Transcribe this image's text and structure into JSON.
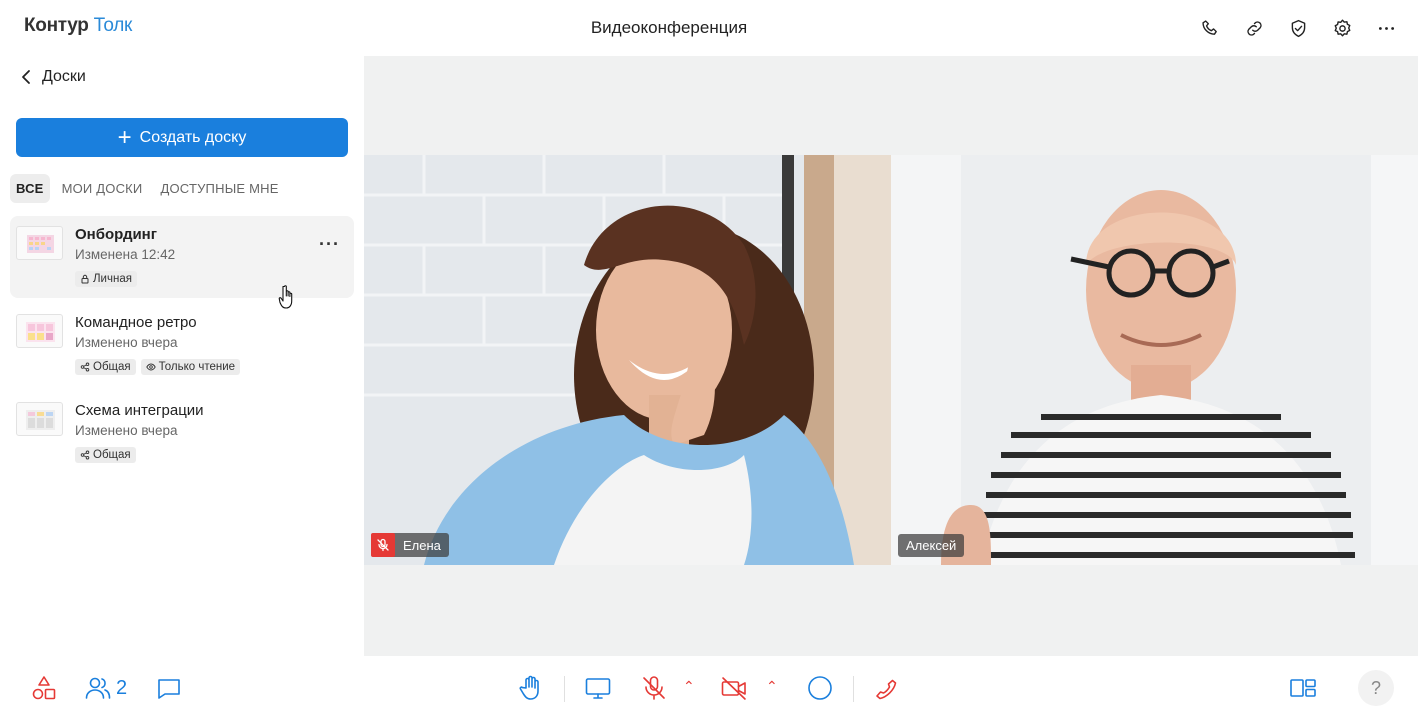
{
  "header": {
    "logo_brand": "Контур",
    "logo_product": "Толк",
    "title": "Видеоконференция",
    "icons": [
      "phone-icon",
      "link-icon",
      "shield-check-icon",
      "gear-icon",
      "more-horizontal-icon"
    ]
  },
  "sidebar": {
    "back_label": "Доски",
    "create_label": "Создать доску",
    "tabs": [
      {
        "label": "ВСЕ",
        "active": true
      },
      {
        "label": "МОИ ДОСКИ",
        "active": false
      },
      {
        "label": "ДОСТУПНЫЕ МНЕ",
        "active": false
      }
    ],
    "boards": [
      {
        "name": "Онбординг",
        "date": "Изменена 12:42",
        "badges": [
          "Личная"
        ],
        "selected": true
      },
      {
        "name": "Командное ретро",
        "date": "Изменено вчера",
        "badges": [
          "Общая",
          "Только чтение"
        ],
        "selected": false
      },
      {
        "name": "Схема интеграции",
        "date": "Изменено вчера",
        "badges": [
          "Общая"
        ],
        "selected": false
      }
    ]
  },
  "videos": [
    {
      "participant": "Елена",
      "muted": true
    },
    {
      "participant": "Алексей",
      "muted": false
    }
  ],
  "footer": {
    "participants_count": "2",
    "help_label": "?",
    "accent_color": "#1a7fdd",
    "danger_color": "#e53935"
  }
}
